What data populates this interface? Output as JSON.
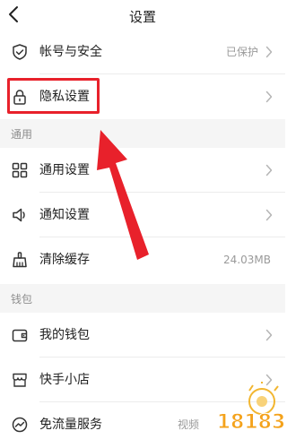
{
  "header": {
    "title": "设置"
  },
  "account_section": {
    "items": [
      {
        "label": "帐号与安全",
        "value": "已保护"
      },
      {
        "label": "隐私设置"
      }
    ]
  },
  "general_section": {
    "title": "通用",
    "items": [
      {
        "label": "通用设置"
      },
      {
        "label": "通知设置"
      },
      {
        "label": "清除缓存",
        "value": "24.03MB"
      }
    ]
  },
  "wallet_section": {
    "title": "钱包",
    "items": [
      {
        "label": "我的钱包"
      },
      {
        "label": "快手小店"
      },
      {
        "label": "免流量服务",
        "value": "视频"
      }
    ]
  },
  "watermark": {
    "text": "18183"
  },
  "colors": {
    "highlight": "#e8212b",
    "separator": "#ececec",
    "section_bg": "#f5f5f5"
  }
}
